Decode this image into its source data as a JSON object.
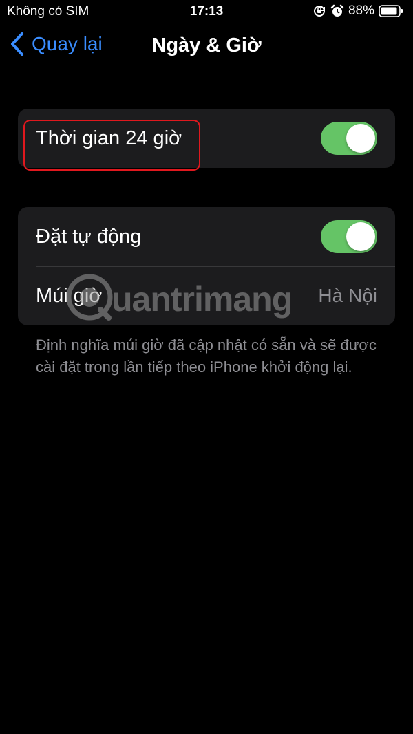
{
  "status_bar": {
    "carrier": "Không có SIM",
    "time": "17:13",
    "battery_percent": "88%",
    "icons": [
      "orientation-lock-icon",
      "alarm-icon",
      "battery-icon"
    ]
  },
  "nav": {
    "back_label": "Quay lại",
    "title": "Ngày & Giờ"
  },
  "settings": {
    "group1": {
      "time_24h_label": "Thời gian 24 giờ",
      "time_24h_on": true
    },
    "group2": {
      "auto_label": "Đặt tự động",
      "auto_on": true,
      "timezone_label": "Múi giờ",
      "timezone_value": "Hà Nội"
    },
    "footnote": "Định nghĩa múi giờ đã cập nhật có sẵn và sẽ được cài đặt trong lần tiếp theo iPhone khởi động lại."
  },
  "watermark": {
    "text": "uantrimang"
  },
  "colors": {
    "accent_blue": "#3a8dff",
    "toggle_on": "#65c466",
    "highlight_red": "#e0181e",
    "group_bg": "#1c1c1e"
  }
}
